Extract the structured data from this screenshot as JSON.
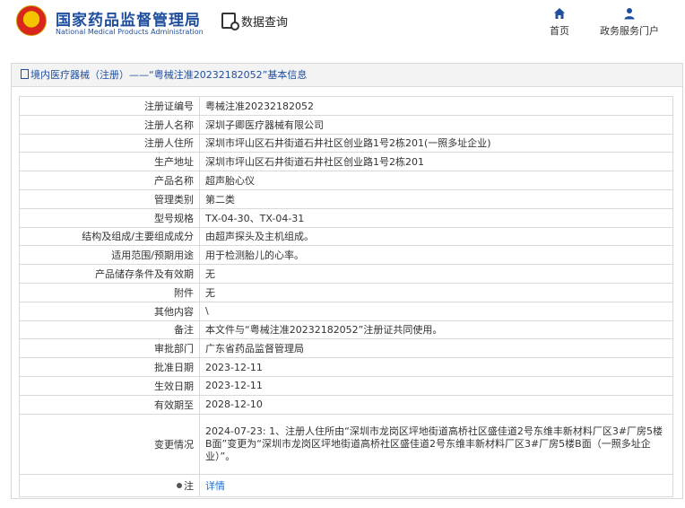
{
  "header": {
    "site_name_cn": "国家药品监督管理局",
    "site_name_en": "National Medical Products Administration",
    "page_title": "数据查询",
    "nav": [
      {
        "label": "首页",
        "icon": "home-icon"
      },
      {
        "label": "政务服务门户",
        "icon": "user-icon"
      }
    ]
  },
  "panel": {
    "title": "境内医疗器械（注册）——“粤械注准20232182052”基本信息",
    "rows": [
      {
        "label": "注册证编号",
        "value": "粤械注准20232182052"
      },
      {
        "label": "注册人名称",
        "value": "深圳子卿医疗器械有限公司"
      },
      {
        "label": "注册人住所",
        "value": "深圳市坪山区石井街道石井社区创业路1号2栋201(一照多址企业)"
      },
      {
        "label": "生产地址",
        "value": "深圳市坪山区石井街道石井社区创业路1号2栋201"
      },
      {
        "label": "产品名称",
        "value": "超声胎心仪"
      },
      {
        "label": "管理类别",
        "value": "第二类"
      },
      {
        "label": "型号规格",
        "value": "TX-04-30、TX-04-31"
      },
      {
        "label": "结构及组成/主要组成成分",
        "value": "由超声探头及主机组成。"
      },
      {
        "label": "适用范围/预期用途",
        "value": "用于检测胎儿的心率。"
      },
      {
        "label": "产品储存条件及有效期",
        "value": "无"
      },
      {
        "label": "附件",
        "value": "无"
      },
      {
        "label": "其他内容",
        "value": "\\"
      },
      {
        "label": "备注",
        "value": "本文件与“粤械注准20232182052”注册证共同使用。"
      },
      {
        "label": "审批部门",
        "value": "广东省药品监督管理局"
      },
      {
        "label": "批准日期",
        "value": "2023-12-11"
      },
      {
        "label": "生效日期",
        "value": "2023-12-11"
      },
      {
        "label": "有效期至",
        "value": "2028-12-10"
      },
      {
        "label": "变更情况",
        "value": "2024-07-23: 1、注册人住所由“深圳市龙岗区坪地街道高桥社区盛佳道2号东维丰新材料厂区3#厂房5楼B面”变更为“深圳市龙岗区坪地街道高桥社区盛佳道2号东维丰新材料厂区3#厂房5楼B面（一照多址企业）”。"
      }
    ],
    "note": {
      "label": "注",
      "link_text": "详情"
    }
  }
}
